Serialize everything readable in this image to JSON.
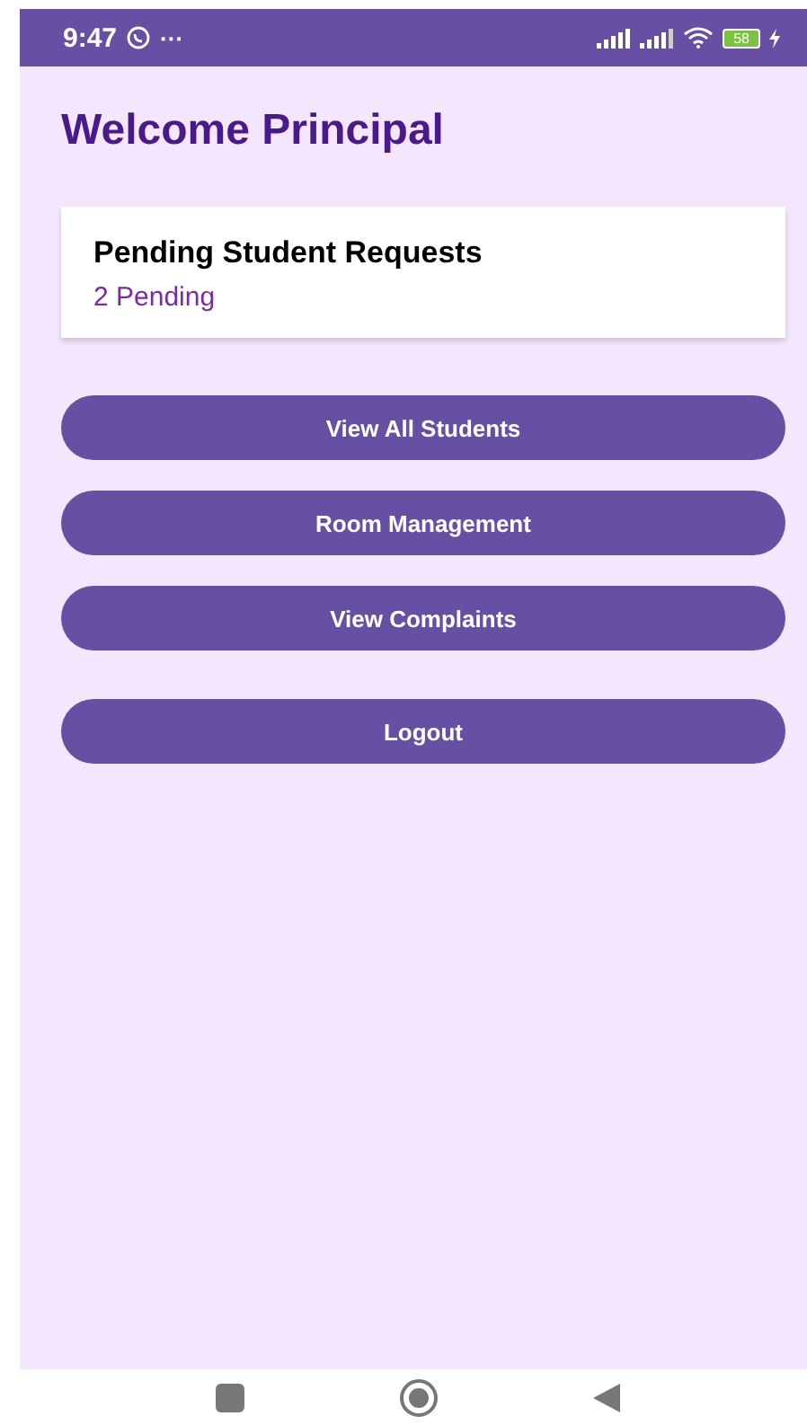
{
  "status_bar": {
    "time": "9:47",
    "more": "···",
    "battery": "58"
  },
  "title": "Welcome Principal",
  "card": {
    "title": "Pending Student Requests",
    "count": "2 Pending"
  },
  "buttons": [
    {
      "label": "View All Students",
      "kind": "action"
    },
    {
      "label": "Room Management",
      "kind": "action"
    },
    {
      "label": "View Complaints",
      "kind": "action"
    },
    {
      "label": "Logout",
      "kind": "logout"
    }
  ]
}
